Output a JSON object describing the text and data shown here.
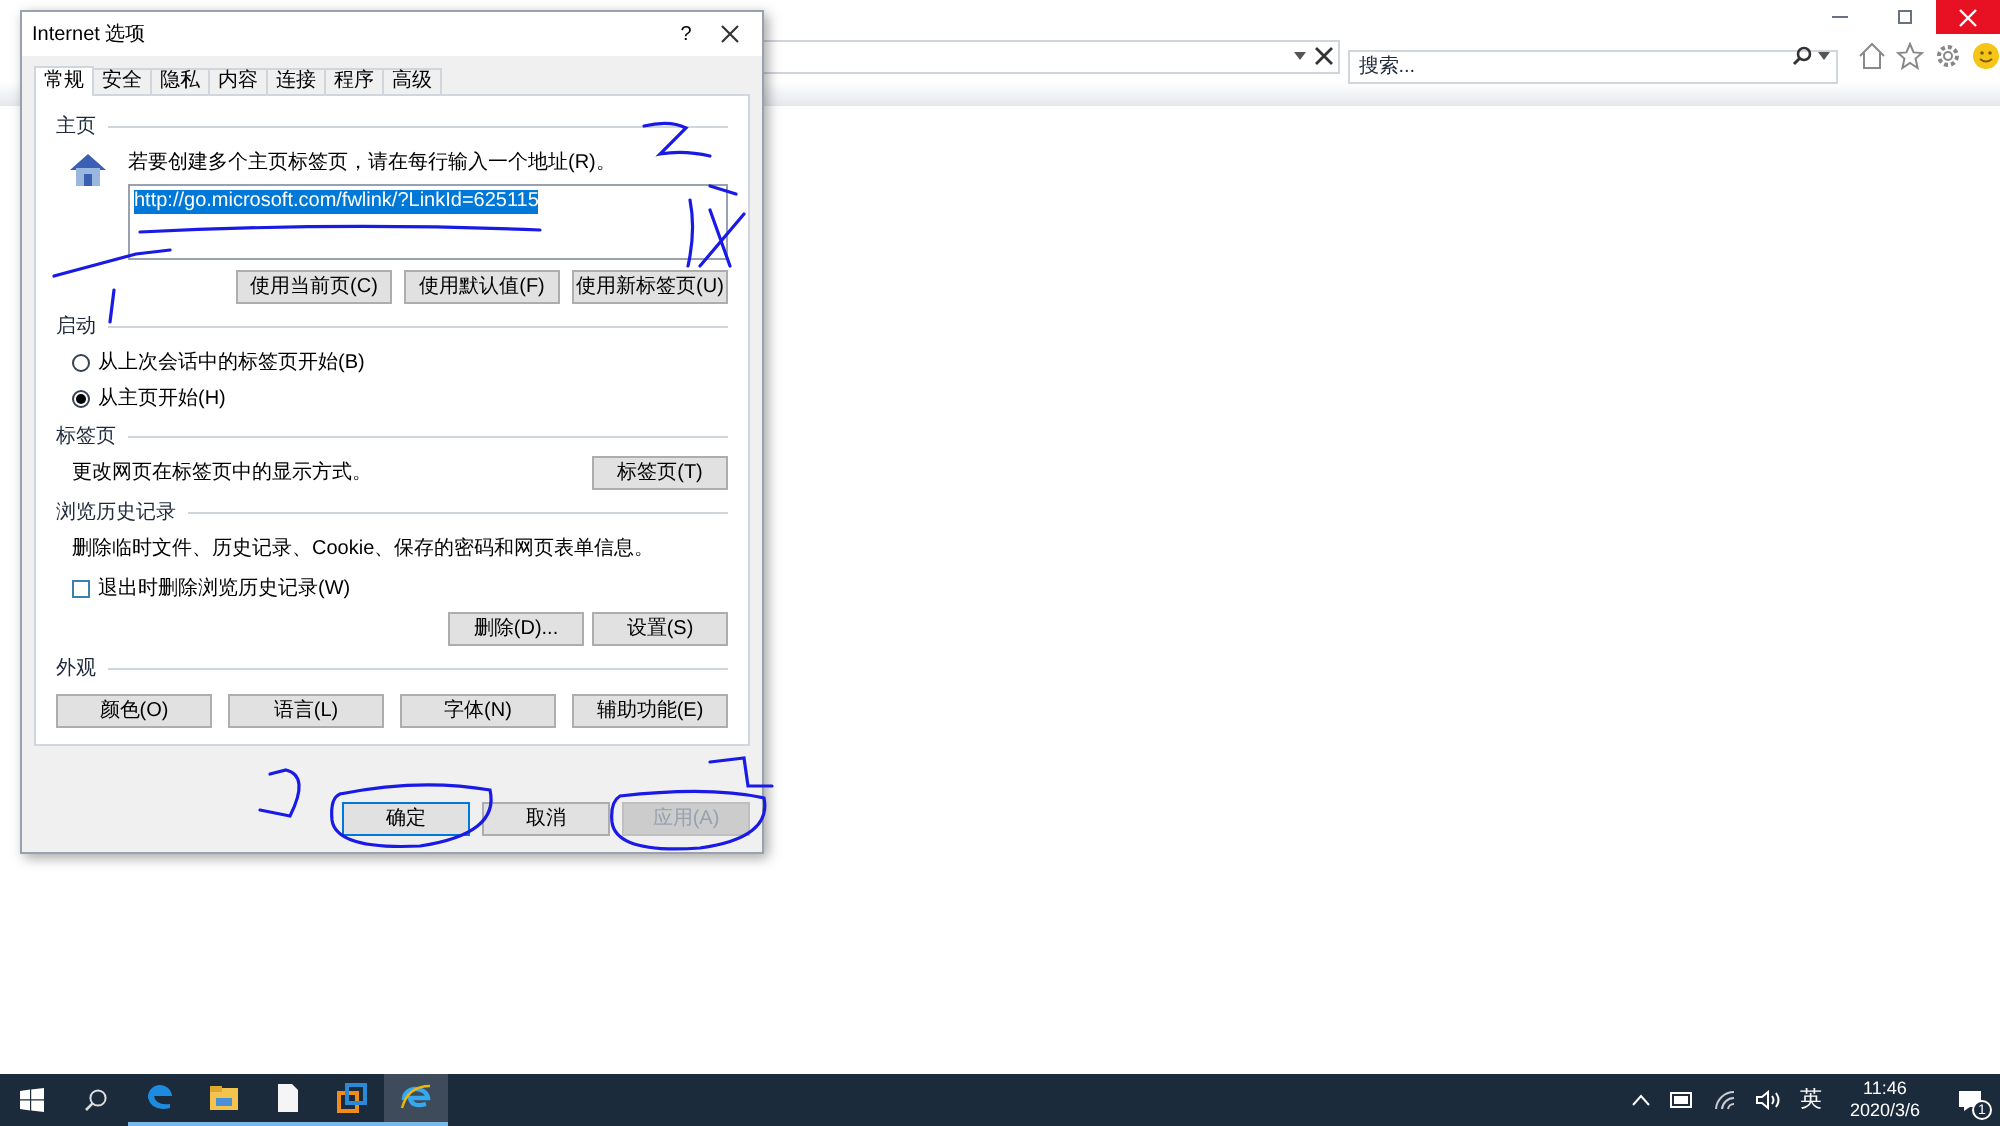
{
  "browser": {
    "search_placeholder": "搜索..."
  },
  "dialog": {
    "title": "Internet 选项",
    "help": "?",
    "tabs": [
      {
        "label": "常规",
        "selected": true
      },
      {
        "label": "安全",
        "selected": false
      },
      {
        "label": "隐私",
        "selected": false
      },
      {
        "label": "内容",
        "selected": false
      },
      {
        "label": "连接",
        "selected": false
      },
      {
        "label": "程序",
        "selected": false
      },
      {
        "label": "高级",
        "selected": false
      }
    ],
    "sections": [
      {
        "kind": "homepage",
        "title": "主页",
        "text": "若要创建多个主页标签页，请在每行输入一个地址(R)。",
        "value": "http://go.microsoft.com/fwlink/?LinkId=625115",
        "highlighted": true,
        "buttons": [
          "使用当前页(C)",
          "使用默认值(F)",
          "使用新标签页(U)"
        ]
      },
      {
        "kind": "startup",
        "title": "启动",
        "options": [
          {
            "label": "从上次会话中的标签页开始(B)",
            "selected": false
          },
          {
            "label": "从主页开始(H)",
            "selected": true
          }
        ]
      },
      {
        "kind": "tabs",
        "title": "标签页",
        "text": "更改网页在标签页中的显示方式。",
        "buttons": [
          "标签页(T)"
        ]
      },
      {
        "kind": "history",
        "title": "浏览历史记录",
        "text": "删除临时文件、历史记录、Cookie、保存的密码和网页表单信息。",
        "checkbox": {
          "label": "退出时删除浏览历史记录(W)",
          "checked": false
        },
        "buttons": [
          "删除(D)...",
          "设置(S)"
        ]
      },
      {
        "kind": "appearance",
        "title": "外观",
        "buttons": [
          "颜色(O)",
          "语言(L)",
          "字体(N)",
          "辅助功能(E)"
        ]
      }
    ],
    "buttons": [
      {
        "label": "确定",
        "default": true,
        "disabled": false
      },
      {
        "label": "取消",
        "default": false,
        "disabled": false
      },
      {
        "label": "应用(A)",
        "default": false,
        "disabled": true
      }
    ]
  },
  "taskbar": {
    "apps": [
      {
        "kind": "edge",
        "selected": false
      },
      {
        "kind": "folder",
        "selected": false
      },
      {
        "kind": "file",
        "selected": false
      },
      {
        "kind": "squares",
        "selected": false
      },
      {
        "kind": "ie",
        "selected": true
      }
    ],
    "ime": "英",
    "time": "11:46",
    "date": "2020/3/6",
    "notifications": "1"
  }
}
